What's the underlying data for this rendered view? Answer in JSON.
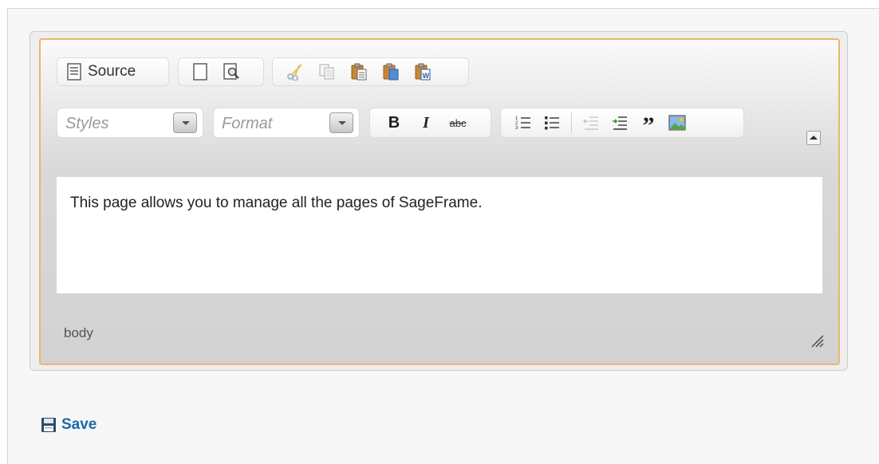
{
  "toolbar": {
    "row1": {
      "source_label": "Source",
      "document_buttons": [
        "new-page",
        "preview"
      ],
      "clipboard_buttons": [
        "cut",
        "copy",
        "paste",
        "paste-as-text",
        "paste-from-word"
      ]
    },
    "row2": {
      "styles_label": "Styles",
      "format_label": "Format",
      "bold_label": "B",
      "italic_label": "I",
      "strike_label": "abc",
      "blockquote_label": "”"
    }
  },
  "editor": {
    "content_text": "This page allows you to manage all the pages of SageFrame.",
    "status_path": "body"
  },
  "actions": {
    "save_label": "Save"
  },
  "icons": [
    "source-icon",
    "new-page-icon",
    "preview-icon",
    "cut-icon",
    "copy-icon",
    "paste-icon",
    "paste-as-text-icon",
    "paste-from-word-icon",
    "numbered-list-icon",
    "bulleted-list-icon",
    "outdent-icon",
    "indent-icon",
    "blockquote-icon",
    "image-icon",
    "collapse-toolbar-icon",
    "resize-handle-icon",
    "save-disk-icon"
  ],
  "colors": {
    "editor_border": "#e8b867",
    "save_link": "#1a6aa5"
  }
}
